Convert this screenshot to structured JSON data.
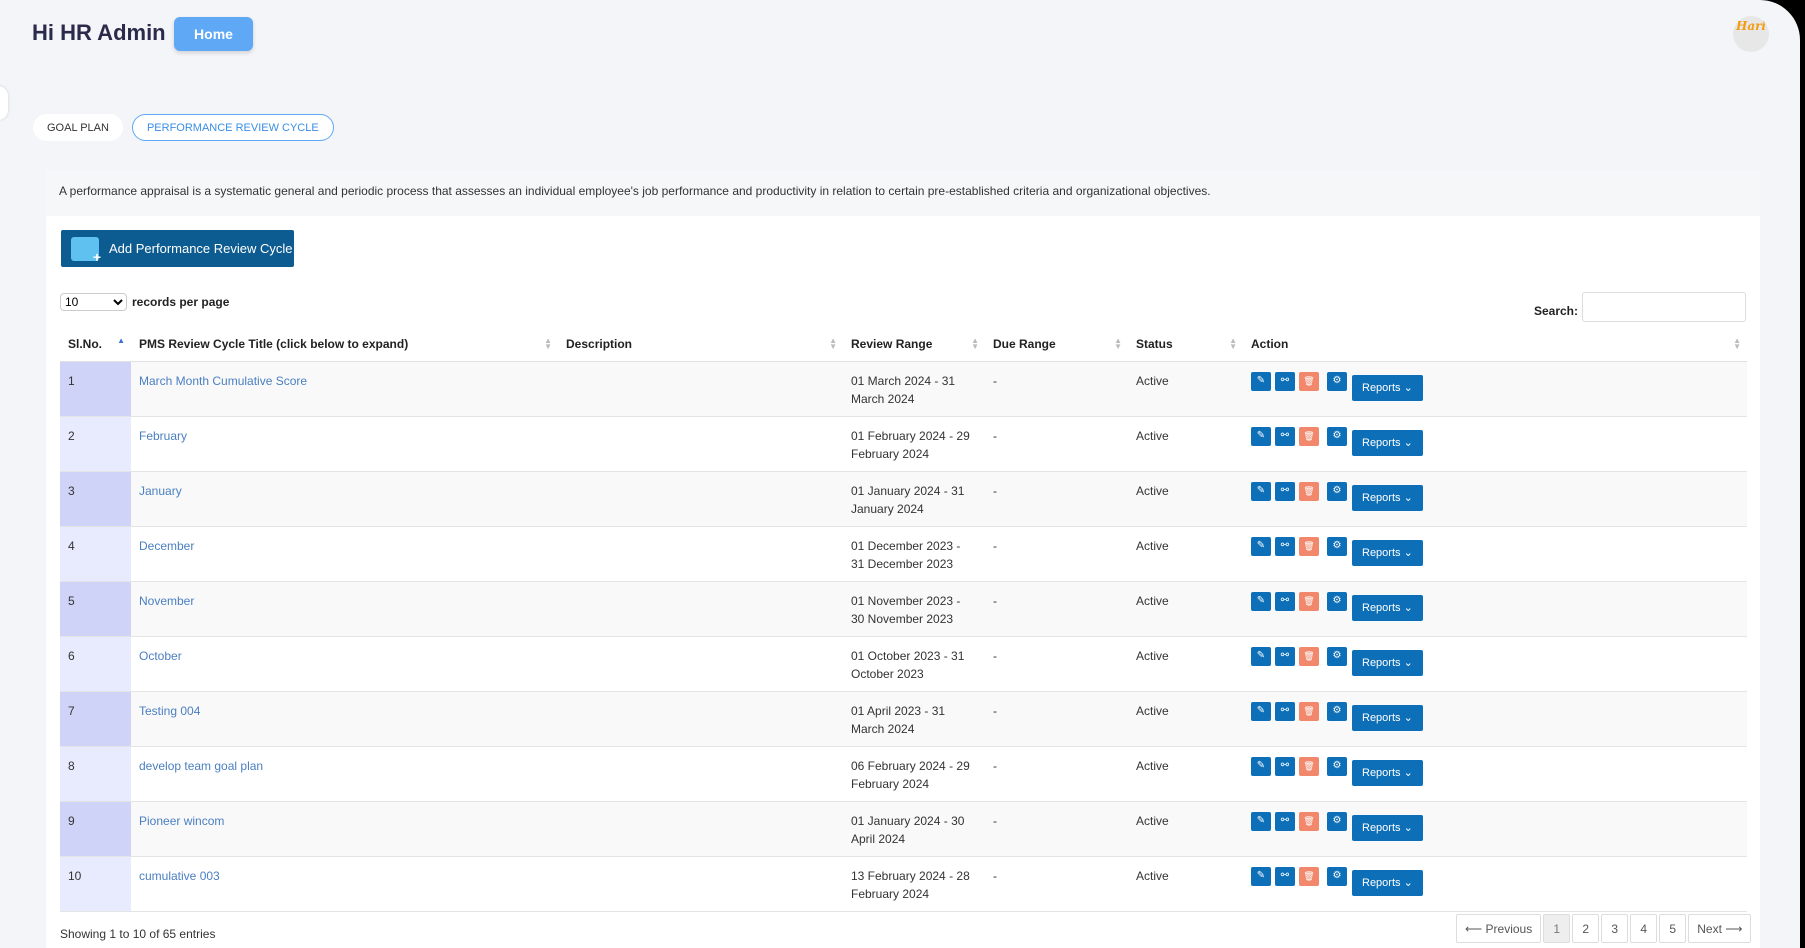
{
  "header": {
    "greeting": "Hi HR Admin",
    "home_label": "Home",
    "avatar_text": "Hari"
  },
  "tabs": [
    {
      "label": "GOAL PLAN"
    },
    {
      "label": "PERFORMANCE REVIEW CYCLE"
    }
  ],
  "intro": "A performance appraisal is a systematic general and periodic process that assesses an individual employee's job performance and productivity in relation to certain pre-established criteria and organizational objectives.",
  "add_button": "Add Performance Review Cycle",
  "per_page": {
    "value": "10",
    "label": "records per page"
  },
  "search_label": "Search:",
  "columns": [
    "Sl.No.",
    "PMS Review Cycle Title (click below to expand)",
    "Description",
    "Review Range",
    "Due Range",
    "Status",
    "Action"
  ],
  "rows": [
    {
      "no": "1",
      "title": "March Month Cumulative Score",
      "description": "",
      "review_range": "01 March 2024 - 31 March 2024",
      "due_range": "-",
      "status": "Active"
    },
    {
      "no": "2",
      "title": "February",
      "description": "",
      "review_range": "01 February 2024 - 29 February 2024",
      "due_range": "-",
      "status": "Active"
    },
    {
      "no": "3",
      "title": "January",
      "description": "",
      "review_range": "01 January 2024 - 31 January 2024",
      "due_range": "-",
      "status": "Active"
    },
    {
      "no": "4",
      "title": "December",
      "description": "",
      "review_range": "01 December 2023 - 31 December 2023",
      "due_range": "-",
      "status": "Active"
    },
    {
      "no": "5",
      "title": "November",
      "description": "",
      "review_range": "01 November 2023 - 30 November 2023",
      "due_range": "-",
      "status": "Active"
    },
    {
      "no": "6",
      "title": "October",
      "description": "",
      "review_range": "01 October 2023 - 31 October 2023",
      "due_range": "-",
      "status": "Active"
    },
    {
      "no": "7",
      "title": "Testing 004",
      "description": "",
      "review_range": "01 April 2023 - 31 March 2024",
      "due_range": "-",
      "status": "Active"
    },
    {
      "no": "8",
      "title": "develop team goal plan",
      "description": "",
      "review_range": "06 February 2024 - 29 February 2024",
      "due_range": "-",
      "status": "Active"
    },
    {
      "no": "9",
      "title": "Pioneer wincom",
      "description": "",
      "review_range": "01 January 2024 - 30 April 2024",
      "due_range": "-",
      "status": "Active"
    },
    {
      "no": "10",
      "title": "cumulative 003",
      "description": "",
      "review_range": "13 February 2024 - 28 February 2024",
      "due_range": "-",
      "status": "Active"
    }
  ],
  "reports_label": "Reports",
  "action_icons": [
    "pencil-icon",
    "share-nodes-icon",
    "trash-icon",
    "gear-icon"
  ],
  "colors": {
    "primary": "#0d6fb8",
    "danger": "#f1876b",
    "home": "#5ea8f6",
    "link": "#4a7fc1"
  },
  "footer": {
    "showing": "Showing 1 to 10 of 65 entries",
    "pagination": [
      "⟵ Previous",
      "1",
      "2",
      "3",
      "4",
      "5",
      "Next ⟶"
    ],
    "current_page": "1"
  }
}
